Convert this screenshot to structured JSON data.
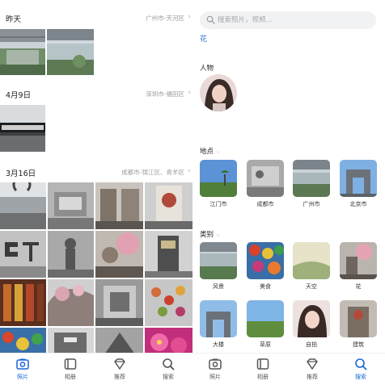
{
  "left": {
    "sections": [
      {
        "date": "昨天",
        "location": "广州市-天河区"
      },
      {
        "date": "4月9日",
        "location": "深圳市-福田区"
      },
      {
        "date": "3月16日",
        "location": "成都市-锦江区、青羊区"
      }
    ],
    "nav": [
      {
        "label": "照片",
        "icon": "photo-icon",
        "active": true
      },
      {
        "label": "相册",
        "icon": "album-icon",
        "active": false
      },
      {
        "label": "推荐",
        "icon": "diamond-icon",
        "active": false
      },
      {
        "label": "搜索",
        "icon": "search-icon",
        "active": false
      }
    ]
  },
  "right": {
    "search": {
      "placeholder": "搜索照片，视频..."
    },
    "suggestion": "花",
    "people_title": "人物",
    "places_title": "地点",
    "places": [
      "江门市",
      "成都市",
      "广州市",
      "北京市"
    ],
    "categories_title": "类别",
    "categories": [
      "风景",
      "美食",
      "天空",
      "花"
    ],
    "more_categories": [
      "大楼",
      "草原",
      "自拍",
      "建筑"
    ],
    "nav": [
      {
        "label": "照片",
        "icon": "photo-icon",
        "active": false
      },
      {
        "label": "相册",
        "icon": "album-icon",
        "active": false
      },
      {
        "label": "推荐",
        "icon": "diamond-icon",
        "active": false
      },
      {
        "label": "搜索",
        "icon": "search-icon",
        "active": true
      }
    ]
  },
  "colors": {
    "accent": "#1a66d9",
    "link": "#2f6fd6"
  }
}
